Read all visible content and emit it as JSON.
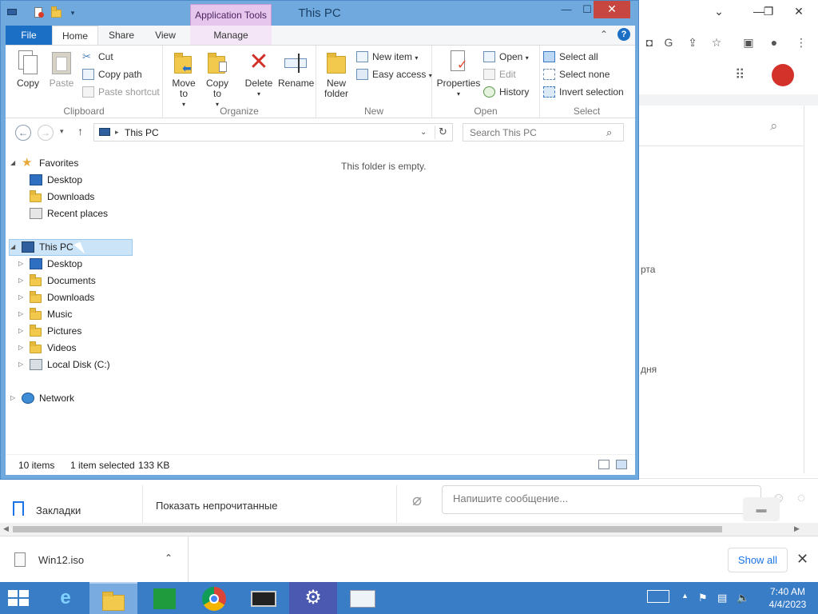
{
  "explorer": {
    "title": "This PC",
    "contextual_tab": "Application Tools",
    "tabs": {
      "file": "File",
      "home": "Home",
      "share": "Share",
      "view": "View",
      "manage": "Manage"
    },
    "ribbon": {
      "clipboard": {
        "label": "Clipboard",
        "copy": "Copy",
        "paste": "Paste",
        "cut": "Cut",
        "copy_path": "Copy path",
        "paste_shortcut": "Paste shortcut"
      },
      "organize": {
        "label": "Organize",
        "move_to": "Move to",
        "copy_to": "Copy to",
        "delete": "Delete",
        "rename": "Rename"
      },
      "new": {
        "label": "New",
        "new_folder": "New folder",
        "new_item": "New item",
        "easy_access": "Easy access"
      },
      "open": {
        "label": "Open",
        "properties": "Properties",
        "open": "Open",
        "edit": "Edit",
        "history": "History"
      },
      "select": {
        "label": "Select",
        "select_all": "Select all",
        "select_none": "Select none",
        "invert_selection": "Invert selection"
      }
    },
    "address": {
      "path": "This PC",
      "search_placeholder": "Search This PC"
    },
    "tree": {
      "favorites": "Favorites",
      "desktop_fav": "Desktop",
      "downloads_fav": "Downloads",
      "recent": "Recent places",
      "this_pc": "This PC",
      "pc_items": [
        "Desktop",
        "Documents",
        "Downloads",
        "Music",
        "Pictures",
        "Videos",
        "Local Disk (C:)"
      ],
      "network": "Network"
    },
    "content": {
      "empty": "This folder is empty."
    },
    "status": {
      "count": "10 items",
      "selected": "1 item selected",
      "size": "133 KB"
    }
  },
  "browser": {
    "fragments": {
      "a": "рта",
      "b": "дня"
    },
    "bookmarks_label": "Закладки",
    "unread_label": "Показать непрочитанные",
    "message_placeholder": "Напишите сообщение...",
    "download_file": "Win12.iso",
    "show_all": "Show all"
  },
  "taskbar": {
    "time": "7:40 AM",
    "date": "4/4/2023"
  },
  "colors": {
    "accent": "#1b6fc4",
    "taskbar": "#3a7dc7",
    "window_frame": "#6fa9dd",
    "selection": "#cce4f7"
  }
}
